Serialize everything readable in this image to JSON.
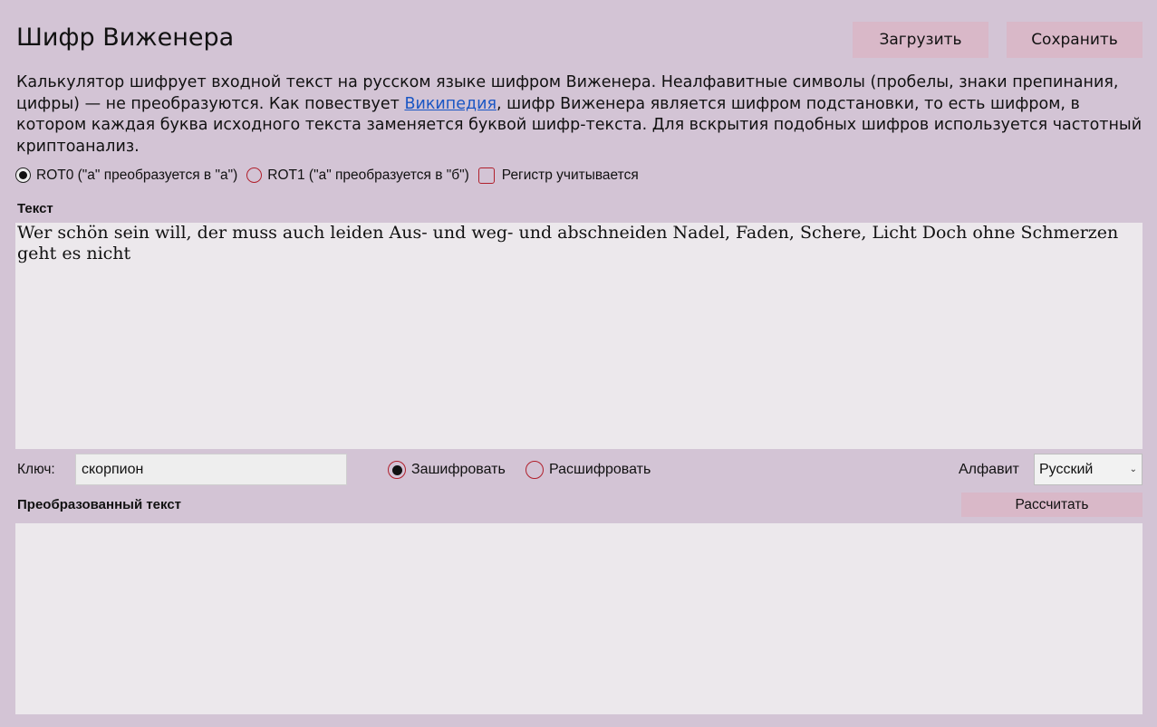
{
  "header": {
    "title": "Шифр Виженера",
    "load_label": "Загрузить",
    "save_label": "Сохранить"
  },
  "description": {
    "before_link": "Калькулятор шифрует входной текст на русском языке шифром Виженера. Неалфавитные символы (пробелы, знаки препинания, цифры) — не преобразуются. Как повествует ",
    "link_text": "Википедия",
    "after_link": ", шифр Виженера является шифром подстановки, то есть шифром, в котором каждая буква исходного текста заменяется буквой шифр-текста. Для вскрытия подобных шифров используется частотный криптоанализ."
  },
  "options": {
    "rot0_label": "ROT0 (\"а\" преобразуется в \"а\")",
    "rot1_label": "ROT1 (\"а\" преобразуется в \"б\")",
    "case_label": "Регистр учитывается",
    "rot0_selected": true,
    "case_checked": false
  },
  "input": {
    "label": "Текст",
    "value": "Wer schön sein will, der muss auch leiden Aus- und weg- und abschneiden Nadel, Faden, Schere, Licht Doch ohne Schmerzen geht es nicht"
  },
  "key": {
    "label": "Ключ:",
    "value": "скорпион"
  },
  "mode": {
    "encrypt_label": "Зашифровать",
    "decrypt_label": "Расшифровать",
    "selected": "encrypt"
  },
  "alphabet": {
    "label": "Алфавит",
    "selected": "Русский"
  },
  "output": {
    "label": "Преобразованный текст",
    "calc_label": "Рассчитать",
    "value": ""
  },
  "colors": {
    "background": "#d3c4d5",
    "button": "#d9b8c8",
    "textarea": "#ece8ec",
    "link": "#1a56c4",
    "radio_accent": "#b0202c"
  }
}
